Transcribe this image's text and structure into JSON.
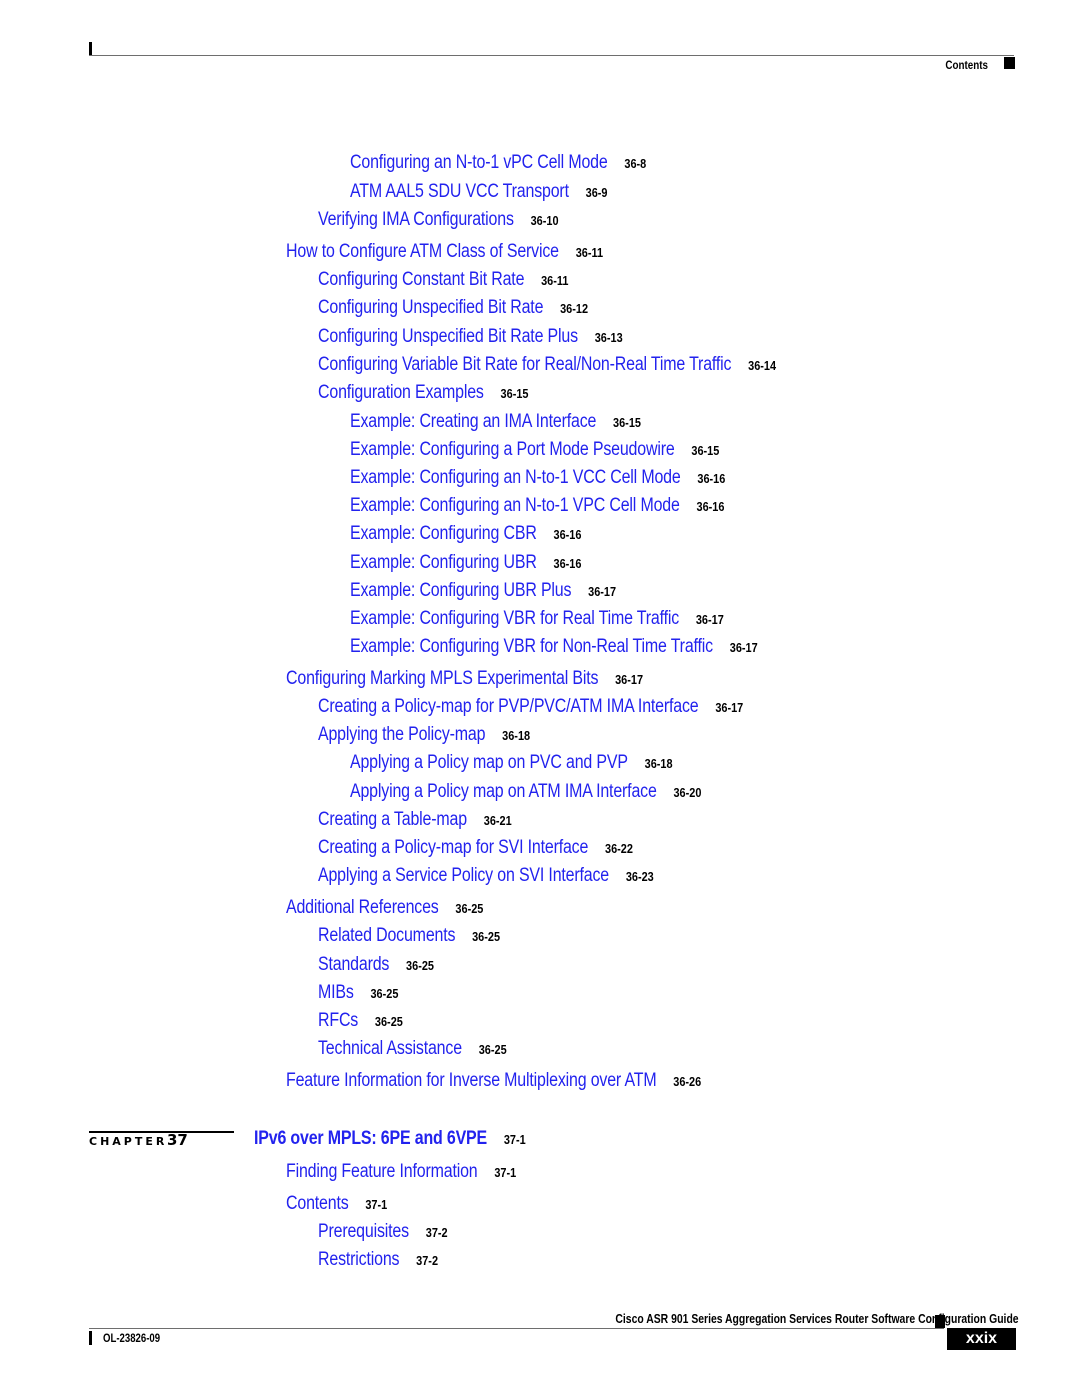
{
  "header": {
    "section_label": "Contents"
  },
  "toc": {
    "entries": [
      {
        "title": "Configuring an N-to-1 vPC Cell Mode",
        "page": "36-8",
        "level": 3
      },
      {
        "title": "ATM AAL5 SDU VCC Transport",
        "page": "36-9",
        "level": 3
      },
      {
        "title": "Verifying IMA Configurations",
        "page": "36-10",
        "level": 2
      },
      {
        "title": "How to Configure ATM Class of Service",
        "page": "36-11",
        "level": 1
      },
      {
        "title": "Configuring Constant Bit Rate",
        "page": "36-11",
        "level": 2
      },
      {
        "title": "Configuring Unspecified Bit Rate",
        "page": "36-12",
        "level": 2
      },
      {
        "title": "Configuring Unspecified Bit Rate Plus",
        "page": "36-13",
        "level": 2
      },
      {
        "title": "Configuring Variable Bit Rate for Real/Non-Real Time Traffic",
        "page": "36-14",
        "level": 2
      },
      {
        "title": "Configuration Examples",
        "page": "36-15",
        "level": 2
      },
      {
        "title": "Example: Creating an IMA Interface",
        "page": "36-15",
        "level": 3
      },
      {
        "title": "Example: Configuring a Port Mode Pseudowire",
        "page": "36-15",
        "level": 3
      },
      {
        "title": "Example: Configuring an N-to-1 VCC Cell Mode",
        "page": "36-16",
        "level": 3
      },
      {
        "title": "Example: Configuring an N-to-1 VPC Cell Mode",
        "page": "36-16",
        "level": 3
      },
      {
        "title": "Example: Configuring CBR",
        "page": "36-16",
        "level": 3
      },
      {
        "title": "Example: Configuring UBR",
        "page": "36-16",
        "level": 3
      },
      {
        "title": "Example: Configuring UBR Plus",
        "page": "36-17",
        "level": 3
      },
      {
        "title": "Example: Configuring VBR for Real Time Traffic",
        "page": "36-17",
        "level": 3
      },
      {
        "title": "Example: Configuring VBR for Non-Real Time Traffic",
        "page": "36-17",
        "level": 3
      },
      {
        "title": "Configuring Marking MPLS Experimental Bits",
        "page": "36-17",
        "level": 1
      },
      {
        "title": "Creating a Policy-map for PVP/PVC/ATM IMA Interface",
        "page": "36-17",
        "level": 2
      },
      {
        "title": "Applying the Policy-map",
        "page": "36-18",
        "level": 2
      },
      {
        "title": "Applying a Policy map on PVC and PVP",
        "page": "36-18",
        "level": 3
      },
      {
        "title": "Applying a Policy map on ATM IMA Interface",
        "page": "36-20",
        "level": 3
      },
      {
        "title": "Creating a Table-map",
        "page": "36-21",
        "level": 2
      },
      {
        "title": "Creating a Policy-map for SVI Interface",
        "page": "36-22",
        "level": 2
      },
      {
        "title": "Applying a Service Policy on SVI Interface",
        "page": "36-23",
        "level": 2
      },
      {
        "title": "Additional References",
        "page": "36-25",
        "level": 1
      },
      {
        "title": "Related Documents",
        "page": "36-25",
        "level": 2
      },
      {
        "title": "Standards",
        "page": "36-25",
        "level": 2
      },
      {
        "title": "MIBs",
        "page": "36-25",
        "level": 2
      },
      {
        "title": "RFCs",
        "page": "36-25",
        "level": 2
      },
      {
        "title": "Technical Assistance",
        "page": "36-25",
        "level": 2
      },
      {
        "title": "Feature Information for Inverse Multiplexing over ATM",
        "page": "36-26",
        "level": 1
      }
    ],
    "chapter": {
      "label": "CHAPTER",
      "number": "37",
      "title": "IPv6 over MPLS: 6PE and 6VPE",
      "page": "37-1"
    },
    "chapter_entries": [
      {
        "title": "Finding Feature Information",
        "page": "37-1",
        "level": 1
      },
      {
        "title": "Contents",
        "page": "37-1",
        "level": 1
      },
      {
        "title": "Prerequisites",
        "page": "37-2",
        "level": 2
      },
      {
        "title": "Restrictions",
        "page": "37-2",
        "level": 2
      }
    ]
  },
  "footer": {
    "guide_title": "Cisco ASR 901 Series Aggregation Services Router Software Configuration Guide",
    "doc_number": "OL-23826-09",
    "page_number": "xxix"
  },
  "colors": {
    "link": "#2222ee",
    "text": "#000000"
  }
}
